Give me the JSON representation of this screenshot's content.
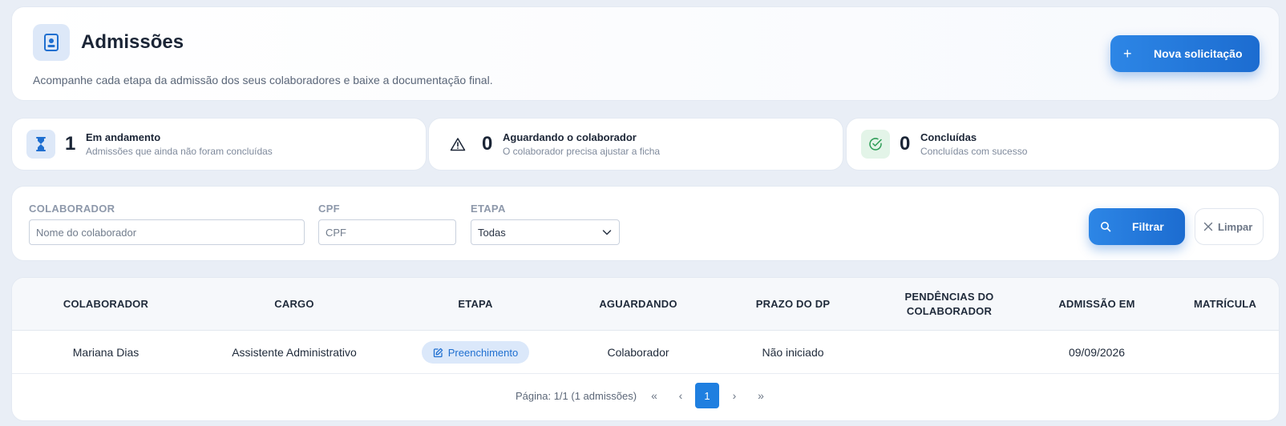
{
  "header": {
    "icon": "badge-id-icon",
    "title": "Admissões",
    "subtitle": "Acompanhe cada etapa da admissão dos seus colaboradores e baixe a documentação final.",
    "new_request_label": "Nova solicitação",
    "accent": "#1f7fe0"
  },
  "stats": [
    {
      "icon": "hourglass-icon",
      "count": "1",
      "title": "Em andamento",
      "description": "Admissões que ainda não foram concluídas",
      "color": "#1f6fd0"
    },
    {
      "icon": "warning-icon",
      "count": "0",
      "title": "Aguardando o colaborador",
      "description": "O colaborador precisa ajustar a ficha",
      "color": "#1b2536"
    },
    {
      "icon": "check-circle-icon",
      "count": "0",
      "title": "Concluídas",
      "description": "Concluídas com sucesso",
      "color": "#2e9d57"
    }
  ],
  "filters": {
    "collaborator_label": "COLABORADOR",
    "collaborator_placeholder": "Nome do colaborador",
    "cpf_label": "CPF",
    "cpf_placeholder": "CPF",
    "stage_label": "ETAPA",
    "stage_value": "Todas",
    "filter_button": "Filtrar",
    "clear_button": "Limpar"
  },
  "table": {
    "columns": [
      "COLABORADOR",
      "CARGO",
      "ETAPA",
      "AGUARDANDO",
      "PRAZO DO DP",
      "PENDÊNCIAS DO COLABORADOR",
      "ADMISSÃO EM",
      "MATRÍCULA"
    ],
    "rows": [
      {
        "collaborator": "Mariana Dias",
        "role": "Assistente Administrativo",
        "stage": "Preenchimento",
        "waiting": "Colaborador",
        "deadline": "Não iniciado",
        "pending": "",
        "admission_date": "09/09/2026",
        "registration": ""
      }
    ]
  },
  "pagination": {
    "info": "Página: 1/1 (1 admissões)",
    "first": "«",
    "prev": "‹",
    "current": "1",
    "next": "›",
    "last": "»"
  }
}
